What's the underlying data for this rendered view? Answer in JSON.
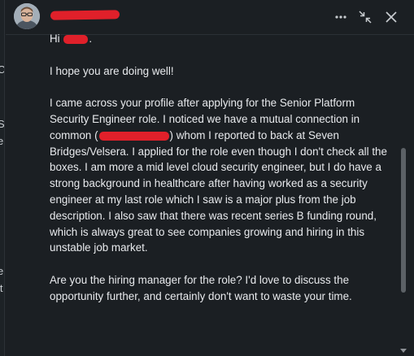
{
  "background": {
    "fragments": [
      "C",
      "S",
      "e",
      ",",
      "e",
      "it"
    ]
  },
  "conversation": {
    "contact_name": "redacted",
    "greeting_prefix": "Hi ",
    "greeting_suffix": ".",
    "paragraph_1": "I hope you are doing well!",
    "paragraph_2_before": "I came across your profile after applying for the Senior Platform Security Engineer role. I noticed we have a mutual connection in common (",
    "paragraph_2_after": ") whom I reported to back at Seven Bridges/Velsera. I applied for the role even though I don't check all the boxes. I am more a mid level cloud security engineer, but I do have a strong background in healthcare after having worked as a security engineer at my last role which I saw is a major plus from the job description. I also saw that there was recent series B funding round, which is always great to see companies growing and hiring in this unstable job market.",
    "paragraph_3": "Are you the hiring manager for the role? I'd love to discuss the opportunity further, and certainly don't want to waste your time."
  },
  "icons": {
    "more": "more-horizontal-icon",
    "minimize": "collapse-icon",
    "close": "close-icon"
  },
  "colors": {
    "background": "#1b1f23",
    "text": "#e8eaed",
    "redaction": "#e0202a",
    "icon": "#c7cbcf"
  }
}
